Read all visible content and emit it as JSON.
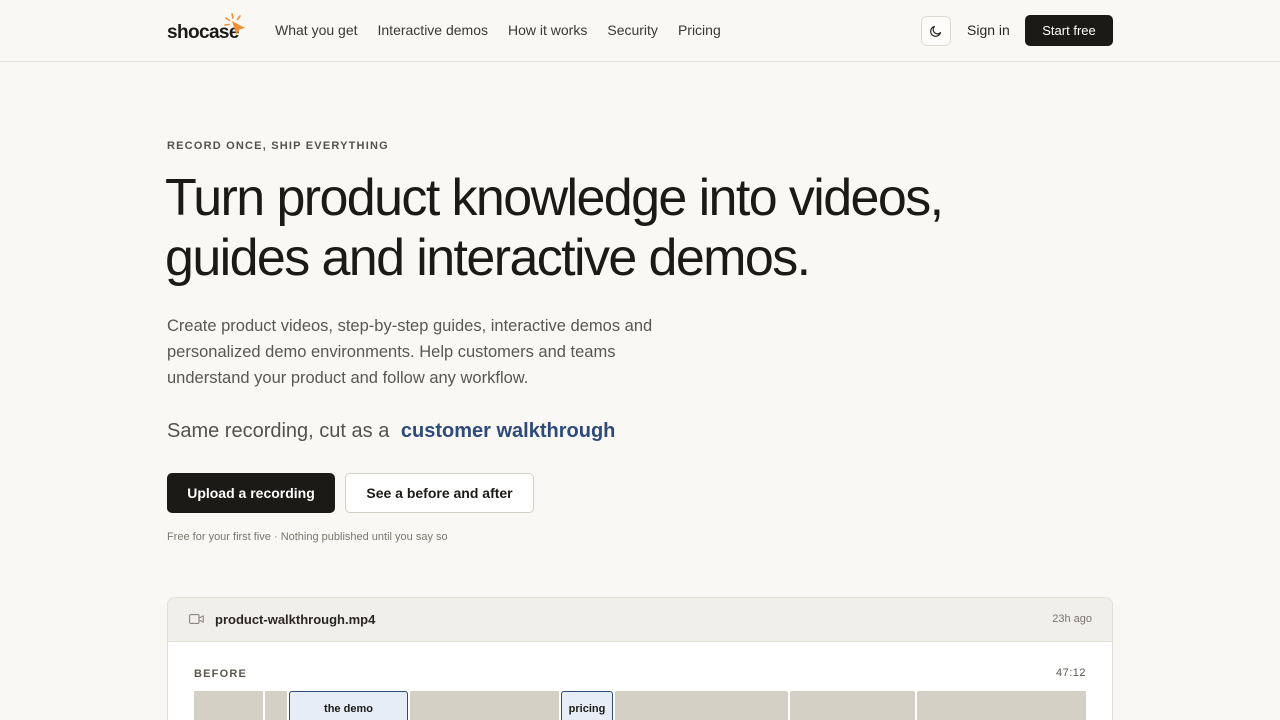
{
  "brand": {
    "name": "shocase",
    "accent_color": "#f0913a"
  },
  "nav": {
    "items": [
      "What you get",
      "Interactive demos",
      "How it works",
      "Security",
      "Pricing"
    ]
  },
  "header": {
    "theme_icon": "moon-icon",
    "sign_in": "Sign in",
    "start_free": "Start free"
  },
  "hero": {
    "eyebrow": "RECORD ONCE, SHIP EVERYTHING",
    "headline_line1": "Turn product knowledge into videos,",
    "headline_line2": "guides and interactive demos.",
    "description": "Create product videos, step-by-step guides, interactive demos and personalized demo environments. Help customers and teams understand your product and follow any workflow.",
    "cut_prefix": "Same recording, cut as a",
    "cut_target": "customer walkthrough",
    "cut_color": "#2e4a78",
    "primary_cta": "Upload a recording",
    "secondary_cta": "See a before and after",
    "fineprint": "Free for your first five · Nothing published until you say so"
  },
  "recording": {
    "file_icon": "video-icon",
    "file_name": "product-walkthrough.mp4",
    "time_ago": "23h ago",
    "before_label": "BEFORE",
    "duration": "47:12",
    "segments": [
      {
        "label": "",
        "highlighted": false
      },
      {
        "label": "",
        "highlighted": false
      },
      {
        "label": "the demo",
        "highlighted": true
      },
      {
        "label": "",
        "highlighted": false
      },
      {
        "label": "pricing",
        "highlighted": true
      },
      {
        "label": "",
        "highlighted": false
      },
      {
        "label": "",
        "highlighted": false
      },
      {
        "label": "",
        "highlighted": false
      }
    ]
  }
}
